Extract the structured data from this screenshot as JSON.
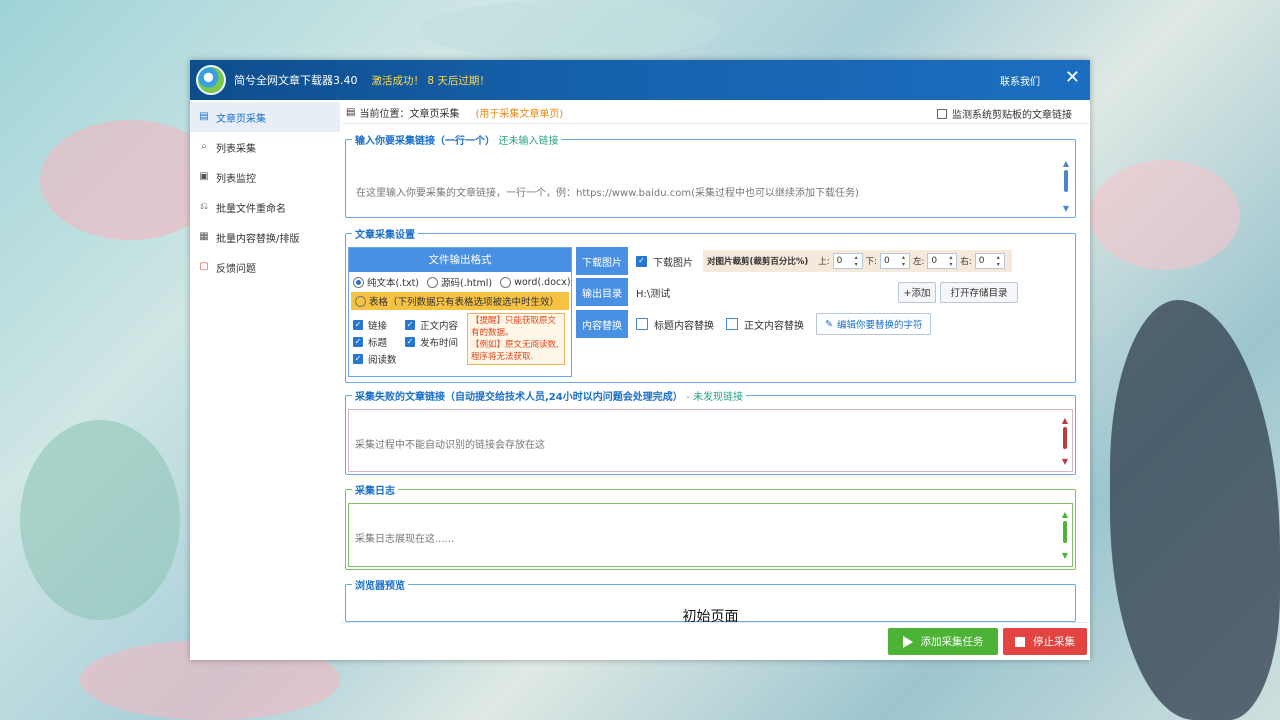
{
  "window": {
    "title": "简兮全网文章下载器3.40",
    "activated": "激活成功！ 8 天后过期！",
    "contact": "联系我们"
  },
  "sidebar": {
    "items": [
      {
        "label": "文章页采集",
        "icon": "document-icon"
      },
      {
        "label": "列表采集",
        "icon": "list-search-icon"
      },
      {
        "label": "列表监控",
        "icon": "monitor-icon"
      },
      {
        "label": "批量文件重命名",
        "icon": "rename-icon"
      },
      {
        "label": "批量内容替换/排版",
        "icon": "replace-icon"
      },
      {
        "label": "反馈问题",
        "icon": "feedback-icon"
      }
    ]
  },
  "path": {
    "label": "当前位置：文章页采集",
    "hint": "(用于采集文章单页)",
    "monitor_clipboard": "监测系统剪贴板的文章链接"
  },
  "links": {
    "legend": "输入你要采集链接（一行一个）",
    "status": "还未输入链接",
    "placeholder": "在这里输入你要采集的文章链接，一行一个，例：https://www.baidu.com(采集过程中也可以继续添加下载任务)"
  },
  "settings": {
    "legend": "文章采集设置",
    "format_title": "文件输出格式",
    "formats": [
      "纯文本(.txt)",
      "源码(.html)",
      "word(.docx)"
    ],
    "table_option": "表格（下列数据只有表格选项被选中时生效）",
    "fields": [
      "链接",
      "正文内容",
      "标题",
      "发布时间",
      "阅读数"
    ],
    "tip_line1": "【提醒】只能获取原文有的数据。",
    "tip_line2": "【例如】原文无阅读数,程序将无法获取.",
    "download_images_label": "下载图片",
    "download_images_check": "下载图片",
    "crop_label": "对图片裁剪(裁剪百分比%)",
    "crop": [
      {
        "label": "上:",
        "value": "0"
      },
      {
        "label": "下:",
        "value": "0"
      },
      {
        "label": "左:",
        "value": "0"
      },
      {
        "label": "右:",
        "value": "0"
      }
    ],
    "output_dir_label": "输出目录",
    "output_dir_value": "H:\\测试",
    "add_button": "+添加",
    "open_dir_button": "打开存储目录",
    "replace_label": "内容替换",
    "replace_title": "标题内容替换",
    "replace_body": "正文内容替换",
    "edit_replace_button": "编辑你要替换的字符"
  },
  "failed": {
    "legend": "采集失败的文章链接（自动提交给技术人员,24小时以内问题会处理完成）",
    "status": "- 未发现链接",
    "placeholder": "采集过程中不能自动识别的链接会存放在这"
  },
  "log": {
    "legend": "采集日志",
    "placeholder": "采集日志展现在这......"
  },
  "preview": {
    "legend": "浏览器预览",
    "content": "初始页面"
  },
  "actions": {
    "add_task": "添加采集任务",
    "stop": "停止采集"
  },
  "colors": {
    "titlebar": "#1660aa",
    "accent": "#4a90e2",
    "activated": "#ffd84a",
    "green": "#4cb336",
    "red": "#e24541"
  }
}
